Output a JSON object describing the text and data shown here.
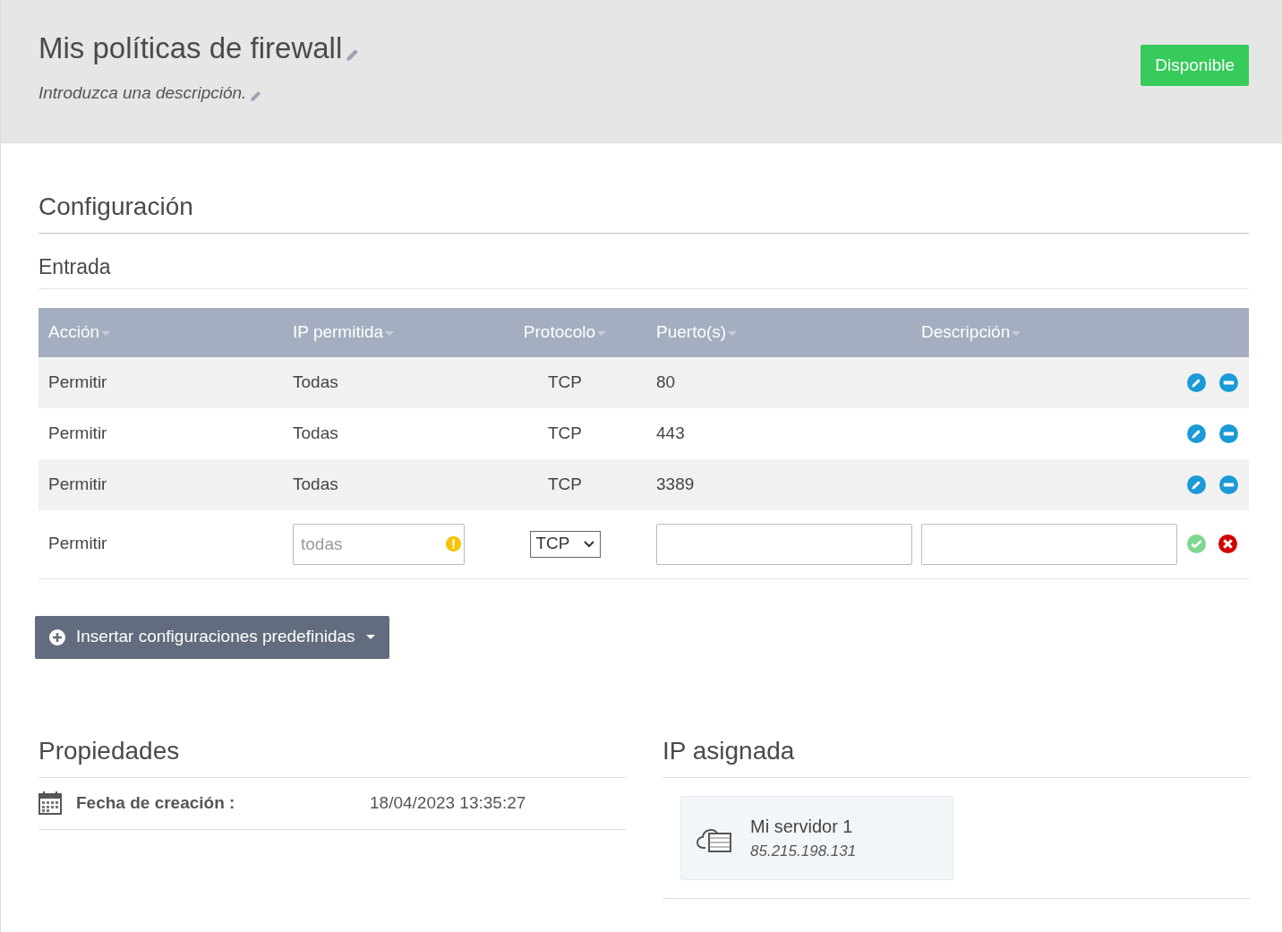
{
  "header": {
    "title": "Mis políticas de firewall",
    "description_placeholder": "Introduzca una descripción.",
    "status_button": "Disponible"
  },
  "configuration": {
    "title": "Configuración",
    "section": "Entrada",
    "columns": [
      "Acción",
      "IP permitida",
      "Protocolo",
      "Puerto(s)",
      "Descripción"
    ],
    "rows": [
      {
        "kind": "rule",
        "action": "Permitir",
        "ip": "Todas",
        "protocol": "TCP",
        "ports": "80"
      },
      {
        "kind": "rule",
        "action": "Permitir",
        "ip": "Todas",
        "protocol": "TCP",
        "ports": "443"
      },
      {
        "kind": "rule",
        "action": "Permitir",
        "ip": "Todas",
        "protocol": "TCP",
        "ports": "3389"
      },
      {
        "kind": "new",
        "action": "Permitir",
        "ip_placeholder": "todas",
        "protocol": "TCP"
      }
    ],
    "insert_button": "Insertar configuraciones predefinidas"
  },
  "properties": {
    "title": "Propiedades",
    "label": "Fecha de creación :",
    "value": "18/04/2023 13:35:27"
  },
  "assigned_ip": {
    "title": "IP asignada",
    "server_name": "Mi servidor 1",
    "server_ip": "85.215.198.131"
  }
}
